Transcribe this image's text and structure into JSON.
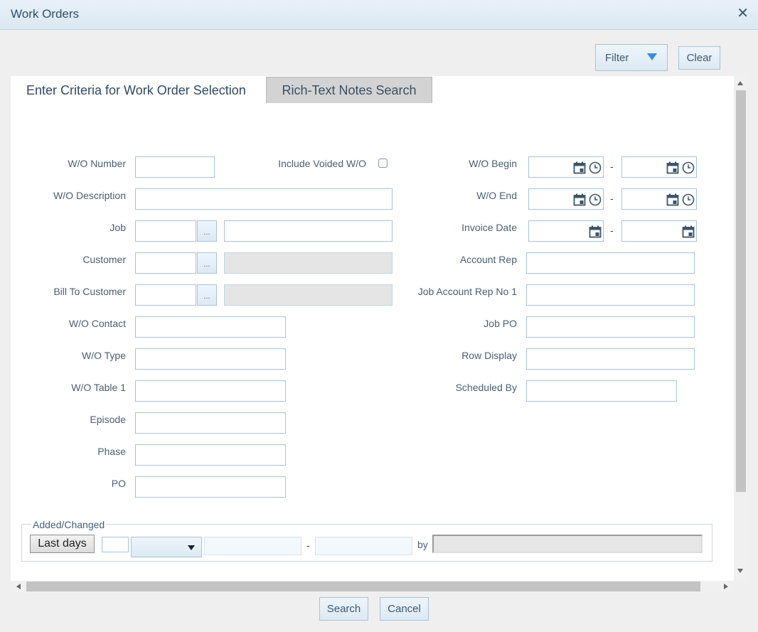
{
  "window": {
    "title": "Work Orders",
    "close_symbol": "✕"
  },
  "toolbar": {
    "filter_label": "Filter",
    "clear_label": "Clear"
  },
  "tabs": {
    "active": "Enter Criteria for Work Order Selection",
    "inactive": "Rich-Text Notes Search"
  },
  "left_fields": {
    "wo_number": "W/O Number",
    "include_voided": "Include Voided W/O",
    "wo_description": "W/O Description",
    "job": "Job",
    "customer": "Customer",
    "bill_to_customer": "Bill To Customer",
    "wo_contact": "W/O Contact",
    "wo_type": "W/O Type",
    "wo_table1": "W/O Table 1",
    "episode": "Episode",
    "phase": "Phase",
    "po": "PO"
  },
  "right_fields": {
    "wo_begin": "W/O Begin",
    "wo_end": "W/O End",
    "invoice_date": "Invoice Date",
    "account_rep": "Account Rep",
    "job_account_rep": "Job Account Rep No 1",
    "job_po": "Job PO",
    "row_display": "Row Display",
    "scheduled_by": "Scheduled By"
  },
  "ellipsis": "...",
  "range_dash": "-",
  "added_changed": {
    "legend": "Added/Changed",
    "last_days_label": "Last days",
    "by_label": "by"
  },
  "footer": {
    "search_label": "Search",
    "cancel_label": "Cancel"
  },
  "colors": {
    "accent": "#3b8de0",
    "border": "#a9c3d8",
    "title_bg": "#dbe8f2",
    "panel": "#ffffff",
    "background": "#efefef"
  },
  "icons": [
    "close-icon",
    "filter-caret-icon",
    "calendar-icon",
    "clock-icon",
    "dropdown-caret-icon",
    "scroll-arrow-icons"
  ]
}
